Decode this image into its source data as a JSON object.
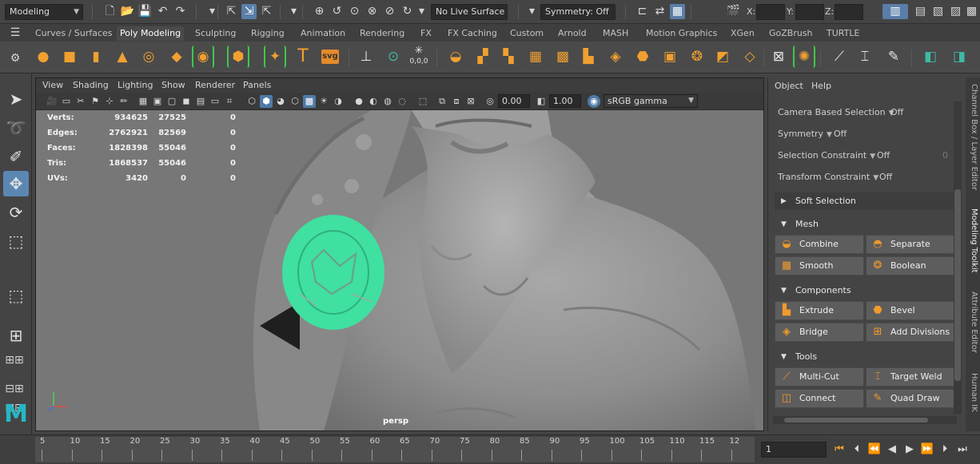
{
  "status_line": {
    "mode_menu": "Modeling",
    "live_surface": "No Live Surface",
    "symmetry": "Symmetry: Off",
    "x_label": "X:",
    "y_label": "Y:",
    "z_label": "Z:"
  },
  "shelf": {
    "tabs": [
      "Curves / Surfaces",
      "Poly Modeling",
      "Sculpting",
      "Rigging",
      "Animation",
      "Rendering",
      "FX",
      "FX Caching",
      "Custom",
      "Arnold",
      "MASH",
      "Motion Graphics",
      "XGen",
      "GoZBrush",
      "TURTLE"
    ],
    "active_tab": "Poly Modeling",
    "text_tool_label": "T",
    "svg_tool_label": "svg",
    "origin_label": "0,0,0"
  },
  "viewport": {
    "menu": [
      "View",
      "Shading",
      "Lighting",
      "Show",
      "Renderer",
      "Panels"
    ],
    "exposure": "0.00",
    "gamma": "1.00",
    "color_space": "sRGB gamma",
    "camera_label": "persp",
    "hud": [
      {
        "label": "Verts:",
        "c1": "934625",
        "c2": "27525",
        "c3": "0"
      },
      {
        "label": "Edges:",
        "c1": "2762921",
        "c2": "82569",
        "c3": "0"
      },
      {
        "label": "Faces:",
        "c1": "1828398",
        "c2": "55046",
        "c3": "0"
      },
      {
        "label": "Tris:",
        "c1": "1868537",
        "c2": "55046",
        "c3": "0"
      },
      {
        "label": "UVs:",
        "c1": "3420",
        "c2": "0",
        "c3": "0"
      }
    ],
    "selection_color": "#3fe0a0"
  },
  "modeling_toolkit": {
    "menu": [
      "Object",
      "Help"
    ],
    "camera_based_selection": {
      "label": "Camera Based Selection",
      "value": "Off"
    },
    "symmetry": {
      "label": "Symmetry",
      "value": "Off"
    },
    "selection_constraint": {
      "label": "Selection Constraint",
      "value": "Off",
      "extra": "0"
    },
    "transform_constraint": {
      "label": "Transform Constraint",
      "value": "Off"
    },
    "soft_selection": "Soft Selection",
    "sections": {
      "mesh": {
        "title": "Mesh",
        "buttons": [
          "Combine",
          "Separate",
          "Smooth",
          "Boolean"
        ]
      },
      "components": {
        "title": "Components",
        "buttons": [
          "Extrude",
          "Bevel",
          "Bridge",
          "Add Divisions"
        ]
      },
      "tools": {
        "title": "Tools",
        "buttons": [
          "Multi-Cut",
          "Target Weld",
          "Connect",
          "Quad Draw"
        ]
      }
    }
  },
  "side_tabs": [
    "Channel Box / Layer Editor",
    "Modeling Toolkit",
    "Attribute Editor",
    "Human IK"
  ],
  "side_tab_active": "Modeling Toolkit",
  "time_slider": {
    "ticks": [
      "5",
      "10",
      "15",
      "20",
      "25",
      "30",
      "35",
      "40",
      "45",
      "50",
      "55",
      "60",
      "65",
      "70",
      "75",
      "80",
      "85",
      "90",
      "95",
      "100",
      "105",
      "110",
      "115",
      "12"
    ],
    "current_frame": "1"
  },
  "logo": "M"
}
